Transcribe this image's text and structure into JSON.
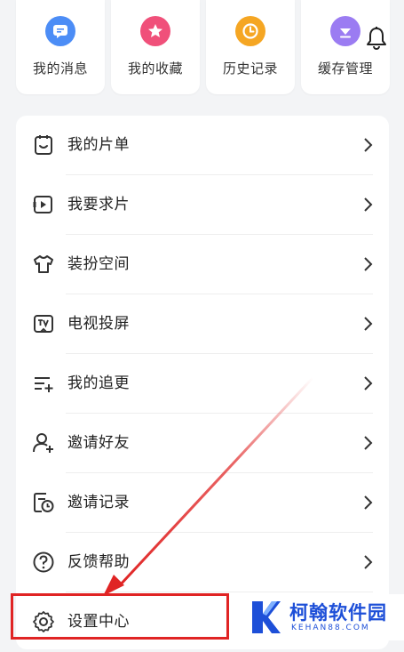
{
  "shortcuts": [
    {
      "label": "我的消息",
      "icon": "message-icon",
      "color": "#4c8df6"
    },
    {
      "label": "我的收藏",
      "icon": "star-icon",
      "color": "#f0507a"
    },
    {
      "label": "历史记录",
      "icon": "clock-icon",
      "color": "#f5a623"
    },
    {
      "label": "缓存管理",
      "icon": "download-icon",
      "color": "#9b7cf2"
    }
  ],
  "header": {
    "bell_icon": "bell-icon"
  },
  "menu": {
    "items": [
      {
        "label": "我的片单",
        "icon": "playlist-icon"
      },
      {
        "label": "我要求片",
        "icon": "video-request-icon"
      },
      {
        "label": "装扮空间",
        "icon": "tshirt-icon"
      },
      {
        "label": "电视投屏",
        "icon": "tv-cast-icon"
      },
      {
        "label": "我的追更",
        "icon": "follow-list-icon"
      },
      {
        "label": "邀请好友",
        "icon": "user-invite-icon"
      },
      {
        "label": "邀请记录",
        "icon": "invite-record-icon"
      },
      {
        "label": "反馈帮助",
        "icon": "help-icon"
      },
      {
        "label": "设置中心",
        "icon": "gear-icon"
      }
    ]
  },
  "annotation": {
    "highlight_color": "#e02424",
    "target": "设置中心"
  },
  "watermark": {
    "text": "柯翰软件园",
    "sub": "KEHAN88.COM",
    "color": "#1d4fd8"
  }
}
